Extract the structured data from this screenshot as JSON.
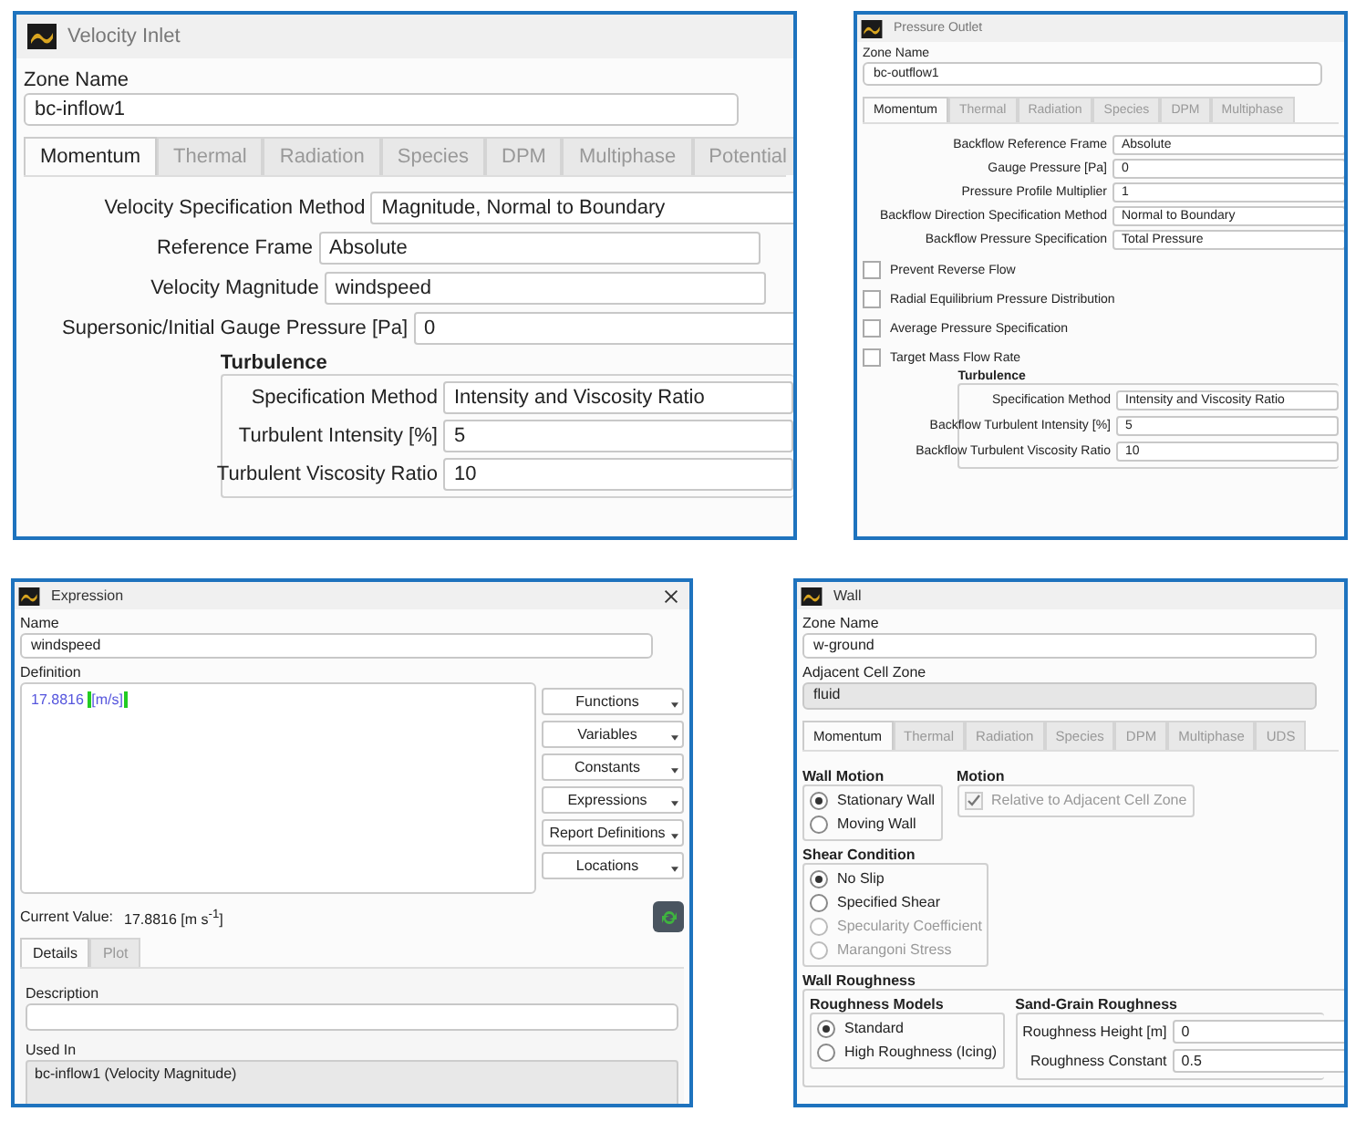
{
  "velocity_inlet": {
    "title": "Velocity Inlet",
    "zone_name_label": "Zone Name",
    "zone_name": "bc-inflow1",
    "tabs": [
      {
        "label": "Momentum",
        "selected": true
      },
      {
        "label": "Thermal",
        "selected": false
      },
      {
        "label": "Radiation",
        "selected": false
      },
      {
        "label": "Species",
        "selected": false
      },
      {
        "label": "DPM",
        "selected": false
      },
      {
        "label": "Multiphase",
        "selected": false
      },
      {
        "label": "Potential",
        "selected": false
      }
    ],
    "fields": [
      {
        "label": "Velocity Specification Method",
        "value": "Magnitude, Normal to Boundary"
      },
      {
        "label": "Reference Frame",
        "value": "Absolute"
      },
      {
        "label": "Velocity Magnitude",
        "value": "windspeed"
      },
      {
        "label": "Supersonic/Initial Gauge Pressure [Pa]",
        "value": "0"
      }
    ],
    "turbulence": {
      "title": "Turbulence",
      "fields": [
        {
          "label": "Specification Method",
          "value": "Intensity and Viscosity Ratio"
        },
        {
          "label": "Turbulent Intensity [%]",
          "value": "5"
        },
        {
          "label": "Turbulent Viscosity Ratio",
          "value": "10"
        }
      ]
    }
  },
  "pressure_outlet": {
    "title": "Pressure Outlet",
    "zone_name_label": "Zone Name",
    "zone_name": "bc-outflow1",
    "tabs": [
      {
        "label": "Momentum",
        "selected": true
      },
      {
        "label": "Thermal",
        "selected": false
      },
      {
        "label": "Radiation",
        "selected": false
      },
      {
        "label": "Species",
        "selected": false
      },
      {
        "label": "DPM",
        "selected": false
      },
      {
        "label": "Multiphase",
        "selected": false
      }
    ],
    "fields": [
      {
        "label": "Backflow Reference Frame",
        "value": "Absolute"
      },
      {
        "label": "Gauge Pressure [Pa]",
        "value": "0"
      },
      {
        "label": "Pressure Profile Multiplier",
        "value": "1"
      },
      {
        "label": "Backflow Direction Specification Method",
        "value": "Normal to Boundary"
      },
      {
        "label": "Backflow Pressure Specification",
        "value": "Total Pressure"
      }
    ],
    "checkboxes": [
      {
        "label": "Prevent Reverse Flow",
        "checked": false
      },
      {
        "label": "Radial Equilibrium Pressure Distribution",
        "checked": false
      },
      {
        "label": "Average Pressure Specification",
        "checked": false
      },
      {
        "label": "Target Mass Flow Rate",
        "checked": false
      }
    ],
    "turbulence": {
      "title": "Turbulence",
      "fields": [
        {
          "label": "Specification Method",
          "value": "Intensity and Viscosity Ratio"
        },
        {
          "label": "Backflow Turbulent Intensity [%]",
          "value": "5"
        },
        {
          "label": "Backflow Turbulent Viscosity Ratio",
          "value": "10"
        }
      ]
    }
  },
  "expression": {
    "title": "Expression",
    "name_label": "Name",
    "name": "windspeed",
    "definition_label": "Definition",
    "definition_number": "17.8816",
    "definition_unit": "[m/s]",
    "buttons": [
      "Functions",
      "Variables",
      "Constants",
      "Expressions",
      "Report Definitions",
      "Locations"
    ],
    "current_value_label": "Current Value:",
    "current_value": "17.8816 [m s$^{-1}$]",
    "tabs": [
      {
        "label": "Details",
        "selected": true
      },
      {
        "label": "Plot",
        "selected": false
      }
    ],
    "description_label": "Description",
    "used_in_label": "Used In",
    "used_in": "bc-inflow1 (Velocity Magnitude)"
  },
  "wall": {
    "title": "Wall",
    "zone_name_label": "Zone Name",
    "zone_name": "w-ground",
    "adjacent_label": "Adjacent Cell Zone",
    "adjacent": "fluid",
    "tabs": [
      {
        "label": "Momentum",
        "selected": true
      },
      {
        "label": "Thermal",
        "selected": false
      },
      {
        "label": "Radiation",
        "selected": false
      },
      {
        "label": "Species",
        "selected": false
      },
      {
        "label": "DPM",
        "selected": false
      },
      {
        "label": "Multiphase",
        "selected": false
      },
      {
        "label": "UDS",
        "selected": false
      }
    ],
    "wall_motion": {
      "title": "Wall Motion",
      "options": [
        {
          "label": "Stationary Wall",
          "selected": true
        },
        {
          "label": "Moving Wall",
          "selected": false
        }
      ]
    },
    "motion": {
      "title": "Motion",
      "label": "Relative to Adjacent Cell Zone",
      "checked": true,
      "disabled": true
    },
    "shear_condition": {
      "title": "Shear Condition",
      "options": [
        {
          "label": "No Slip",
          "selected": true,
          "disabled": false
        },
        {
          "label": "Specified Shear",
          "selected": false,
          "disabled": false
        },
        {
          "label": "Specularity Coefficient",
          "selected": false,
          "disabled": true
        },
        {
          "label": "Marangoni Stress",
          "selected": false,
          "disabled": true
        }
      ]
    },
    "wall_roughness": {
      "title": "Wall Roughness",
      "models_title": "Roughness Models",
      "models": [
        {
          "label": "Standard",
          "selected": true
        },
        {
          "label": "High Roughness (Icing)",
          "selected": false
        }
      ],
      "sand_grain_title": "Sand-Grain Roughness",
      "fields": [
        {
          "label": "Roughness Height [m]",
          "value": "0"
        },
        {
          "label": "Roughness Constant",
          "value": "0.5"
        }
      ]
    }
  }
}
